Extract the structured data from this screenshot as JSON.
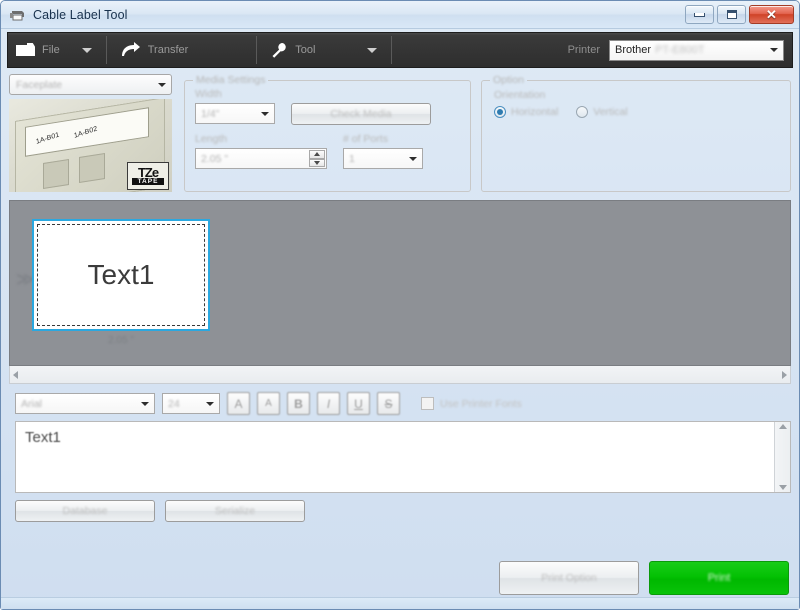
{
  "window": {
    "title": "Cable Label Tool",
    "icon": "printer-icon",
    "minimize": "–",
    "maximize": "□",
    "close": "✕"
  },
  "toolbar": {
    "file_label": "File",
    "transfer_label": "Transfer",
    "tool_label": "Tool",
    "printer_label": "Printer",
    "printer_value": "Brother",
    "printer_model": "PT-E800T"
  },
  "preview": {
    "type_value": "Faceplate",
    "faceplate_label_1": "1A-B01",
    "faceplate_label_2": "1A-B02",
    "tze_top": "TZe",
    "tze_bottom": "TAPE"
  },
  "media_settings": {
    "legend": "Media Settings",
    "width_label": "Width",
    "width_value": "1/4\"",
    "check_media_label": "Check Media",
    "length_label": "Length",
    "length_value": "2.05 \"",
    "ports_label": "# of Ports",
    "ports_value": "1"
  },
  "option": {
    "legend": "Option",
    "orientation_label": "Orientation",
    "horizontal_label": "Horizontal",
    "vertical_label": "Vertical",
    "selected": "Horizontal"
  },
  "canvas": {
    "label_text": "Text1",
    "label_dimension": "2.05 \"",
    "scroll_left": "◀",
    "scroll_right": "▶"
  },
  "font_bar": {
    "font_family_value": "Arial",
    "font_size_value": "24",
    "increase_font": "A",
    "decrease_font": "A",
    "bold": "B",
    "italic": "I",
    "underline": "U",
    "strikethrough": "S",
    "use_printer_fonts_label": "Use Printer Fonts",
    "use_printer_fonts_checked": false
  },
  "editor": {
    "text_value": "Text1",
    "database_label": "Database",
    "serialize_label": "Serialize"
  },
  "actions": {
    "print_option_label": "Print Option",
    "print_label": "Print"
  },
  "colors": {
    "print_green": "#00c400",
    "selection_blue": "#2aa8e0",
    "close_red": "#cf4227",
    "canvas_gray": "#8e9196"
  }
}
